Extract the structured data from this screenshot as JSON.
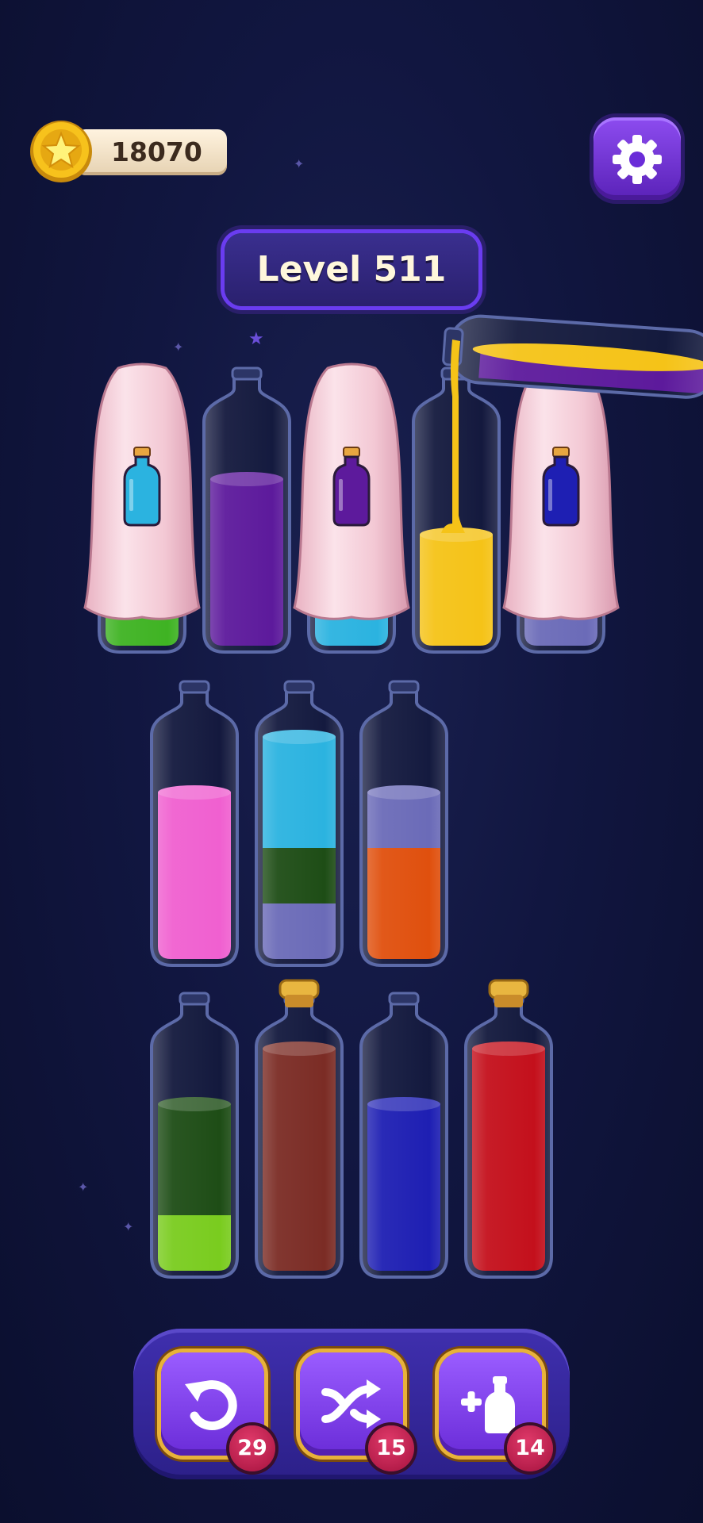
{
  "hud": {
    "coins": "18070",
    "level": "Level 511"
  },
  "tools": {
    "undo_count": "29",
    "shuffle_count": "15",
    "add_tube_count": "14"
  },
  "colors": {
    "green": "#3fb323",
    "purple": "#5d1a9c",
    "sky": "#2bb3e0",
    "yellow": "#f5c318",
    "lavender": "#6b6bb8",
    "pink": "#f060d0",
    "darkgreen": "#1e4d16",
    "lightgreen": "#7acc1f",
    "orange": "#e0500e",
    "brown": "#7b2c25",
    "blue": "#1e1fb3",
    "red": "#c4101c"
  },
  "tubes": [
    {
      "name": "tube-1",
      "hidden": true,
      "hint": "sky",
      "layers": [
        "green"
      ]
    },
    {
      "name": "tube-2",
      "layers": [
        "purple",
        "purple",
        "purple"
      ]
    },
    {
      "name": "tube-3",
      "hidden": true,
      "hint": "purple",
      "layers": [
        "sky"
      ]
    },
    {
      "name": "tube-4",
      "layers": [
        "yellow",
        "yellow"
      ]
    },
    {
      "name": "tube-5",
      "hidden": true,
      "hint": "blue",
      "layers": [
        "lavender"
      ]
    },
    {
      "name": "tube-6",
      "layers": [
        "pink",
        "pink",
        "pink"
      ]
    },
    {
      "name": "tube-7",
      "layers": [
        "lavender",
        "darkgreen",
        "sky",
        "sky"
      ]
    },
    {
      "name": "tube-8",
      "layers": [
        "orange",
        "orange",
        "lavender"
      ]
    },
    {
      "name": "tube-9",
      "layers": [
        "lightgreen",
        "darkgreen",
        "darkgreen"
      ]
    },
    {
      "name": "tube-10",
      "capped": true,
      "layers": [
        "brown",
        "brown",
        "brown",
        "brown"
      ]
    },
    {
      "name": "tube-11",
      "layers": [
        "blue",
        "blue",
        "blue"
      ]
    },
    {
      "name": "tube-12",
      "capped": true,
      "layers": [
        "red",
        "red",
        "red",
        "red"
      ]
    }
  ],
  "pouring_tube": {
    "layers": [
      "purple",
      "yellow"
    ]
  }
}
